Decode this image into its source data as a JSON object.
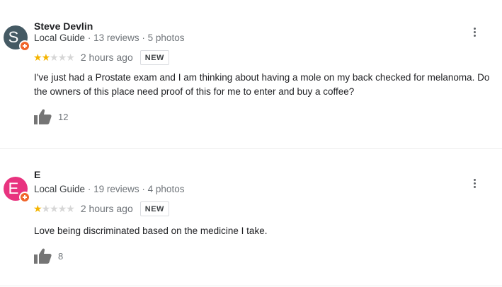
{
  "reviews": [
    {
      "avatar_letter": "S",
      "avatar_color": "#455a64",
      "name": "Steve Devlin",
      "guide_label": "Local Guide",
      "reviews_count": "13 reviews",
      "photos_count": "5 photos",
      "rating": 2,
      "rating_max": 5,
      "time": "2 hours ago",
      "badge": "NEW",
      "text": "I've just had a Prostate exam and I am thinking about having a mole on my back checked for melanoma. Do the owners of this place need proof of this for me to enter and buy a coffee?",
      "likes": "12"
    },
    {
      "avatar_letter": "E",
      "avatar_color": "#e8337f",
      "name": "E",
      "guide_label": "Local Guide",
      "reviews_count": "19 reviews",
      "photos_count": "4 photos",
      "rating": 1,
      "rating_max": 5,
      "time": "2 hours ago",
      "badge": "NEW",
      "text": "Love being discriminated based on the medicine I take.",
      "likes": "8"
    }
  ],
  "separator": "·",
  "icons": {
    "more": "more-vert-icon",
    "like": "thumbs-up-icon",
    "local_guide": "local-guide-badge-icon"
  },
  "colors": {
    "star_on": "#f4b400",
    "star_off": "#d6d6d6",
    "guide_badge": "#f0652a"
  }
}
